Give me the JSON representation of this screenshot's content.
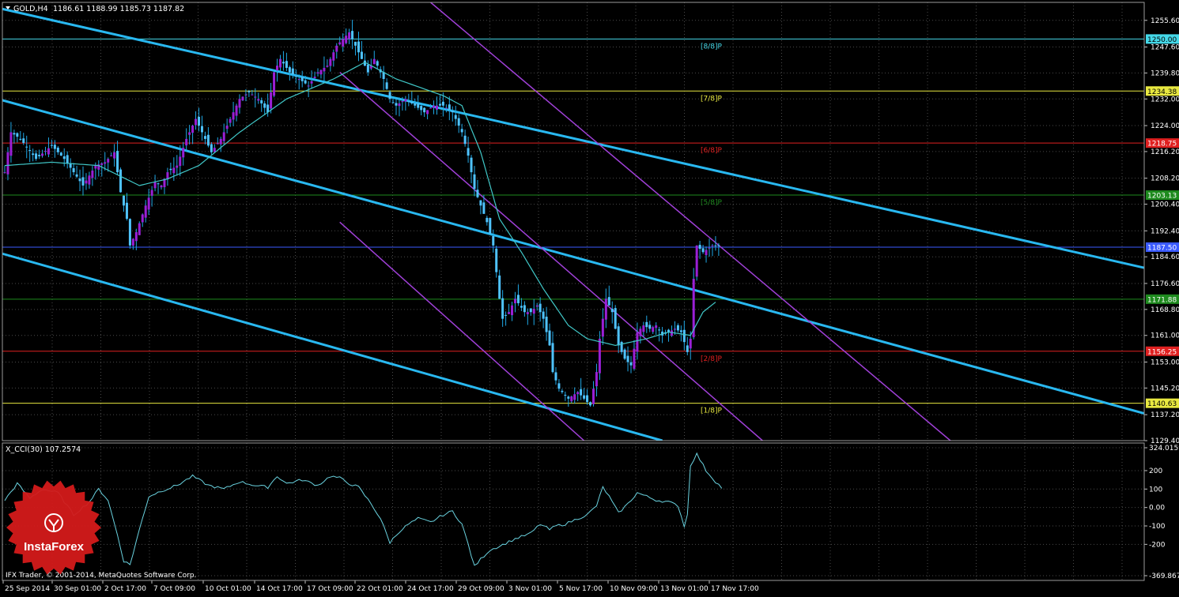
{
  "header": {
    "title": "GOLD,H4",
    "ohlc": "1186.61 1188.99 1185.73 1187.82",
    "menu_icon": "triangle-down-icon"
  },
  "indicator": {
    "label": "X_CCI(30) 107.2574"
  },
  "footer": {
    "copyright": "IFX Trader, © 2001-2014, MetaQuotes Software Corp."
  },
  "watermark": {
    "brand": "InstaForex"
  },
  "colors": {
    "background": "#000000",
    "grid": "#4a4a4a",
    "axis": "#c0c0c0",
    "bull_body": "#9a1fd6",
    "bear_body": "#4fc3ff",
    "wick": "#1fa8e6",
    "ma": "#40c8c8",
    "cci": "#6ad3e0",
    "channel": "#29b8f0",
    "channel_purple": "#a040d8",
    "level_88": "#44d8e8",
    "level_78": "#e8e840",
    "level_68": "#e02020",
    "level_58": "#1e8a1e",
    "level_48": "#3a5aff",
    "level_38": "#1e8a1e",
    "level_28": "#e02020",
    "level_18": "#e8e840",
    "watermark_red": "#d41a1a"
  },
  "chart_data": [
    {
      "type": "candlestick",
      "symbol": "GOLD",
      "timeframe": "H4",
      "ylim": [
        1129.4,
        1261.0
      ],
      "y_ticks": [
        "1255.60",
        "1247.60",
        "1239.80",
        "1232.00",
        "1224.00",
        "1216.20",
        "1208.20",
        "1200.40",
        "1192.40",
        "1184.60",
        "1176.60",
        "1168.80",
        "1161.00",
        "1153.00",
        "1145.20",
        "1137.20",
        "1129.40"
      ],
      "x_ticks": [
        "25 Sep 2014",
        "30 Sep 01:00",
        "2 Oct 17:00",
        "7 Oct 09:00",
        "10 Oct 01:00",
        "14 Oct 17:00",
        "17 Oct 09:00",
        "22 Oct 01:00",
        "24 Oct 17:00",
        "29 Oct 09:00",
        "3 Nov 01:00",
        "5 Nov 17:00",
        "10 Nov 09:00",
        "13 Nov 01:00",
        "17 Nov 17:00"
      ],
      "grid": true,
      "close_anchors": [
        [
          0,
          1210
        ],
        [
          2,
          1222
        ],
        [
          5,
          1220
        ],
        [
          10,
          1214
        ],
        [
          15,
          1218
        ],
        [
          19,
          1214
        ],
        [
          22,
          1210
        ],
        [
          25,
          1206
        ],
        [
          27,
          1209
        ],
        [
          29,
          1212
        ],
        [
          32,
          1213
        ],
        [
          35,
          1216
        ],
        [
          37,
          1204
        ],
        [
          39,
          1196
        ],
        [
          40,
          1188
        ],
        [
          42,
          1192
        ],
        [
          45,
          1200
        ],
        [
          48,
          1207
        ],
        [
          50,
          1206
        ],
        [
          52,
          1210
        ],
        [
          55,
          1212
        ],
        [
          58,
          1220
        ],
        [
          61,
          1226
        ],
        [
          63,
          1222
        ],
        [
          66,
          1216
        ],
        [
          69,
          1220
        ],
        [
          72,
          1226
        ],
        [
          75,
          1232
        ],
        [
          78,
          1234
        ],
        [
          81,
          1232
        ],
        [
          84,
          1228
        ],
        [
          86,
          1240
        ],
        [
          88,
          1244
        ],
        [
          91,
          1240
        ],
        [
          94,
          1238
        ],
        [
          97,
          1236
        ],
        [
          100,
          1240
        ],
        [
          103,
          1242
        ],
        [
          106,
          1248
        ],
        [
          108,
          1250
        ],
        [
          110,
          1252
        ],
        [
          112,
          1248
        ],
        [
          114,
          1244
        ],
        [
          116,
          1240
        ],
        [
          118,
          1244
        ],
        [
          121,
          1238
        ],
        [
          123,
          1232
        ],
        [
          125,
          1230
        ],
        [
          128,
          1232
        ],
        [
          131,
          1230
        ],
        [
          134,
          1228
        ],
        [
          137,
          1230
        ],
        [
          140,
          1230
        ],
        [
          143,
          1228
        ],
        [
          146,
          1222
        ],
        [
          148,
          1215
        ],
        [
          150,
          1205
        ],
        [
          152,
          1200
        ],
        [
          154,
          1195
        ],
        [
          156,
          1188
        ],
        [
          158,
          1172
        ],
        [
          159,
          1166
        ],
        [
          161,
          1168
        ],
        [
          163,
          1172
        ],
        [
          166,
          1168
        ],
        [
          168,
          1168
        ],
        [
          170,
          1170
        ],
        [
          172,
          1166
        ],
        [
          174,
          1158
        ],
        [
          175,
          1150
        ],
        [
          177,
          1145
        ],
        [
          180,
          1142
        ],
        [
          183,
          1144
        ],
        [
          185,
          1142
        ],
        [
          187,
          1140
        ],
        [
          189,
          1150
        ],
        [
          190,
          1160
        ],
        [
          192,
          1172
        ],
        [
          194,
          1168
        ],
        [
          196,
          1158
        ],
        [
          198,
          1154
        ],
        [
          200,
          1152
        ],
        [
          202,
          1162
        ],
        [
          204,
          1164
        ],
        [
          206,
          1163
        ],
        [
          208,
          1164
        ],
        [
          210,
          1161
        ],
        [
          212,
          1162
        ],
        [
          214,
          1163
        ],
        [
          216,
          1162
        ],
        [
          218,
          1156
        ],
        [
          219,
          1160
        ],
        [
          220,
          1178
        ],
        [
          221,
          1188
        ],
        [
          223,
          1186
        ],
        [
          226,
          1188
        ],
        [
          228,
          1187.82
        ]
      ],
      "moving_average": {
        "name": "MA",
        "anchors": [
          [
            0,
            1212
          ],
          [
            15,
            1213
          ],
          [
            30,
            1212
          ],
          [
            43,
            1206
          ],
          [
            52,
            1208
          ],
          [
            62,
            1212
          ],
          [
            75,
            1222
          ],
          [
            90,
            1232
          ],
          [
            105,
            1238
          ],
          [
            115,
            1243
          ],
          [
            125,
            1238
          ],
          [
            140,
            1233
          ],
          [
            146,
            1230
          ],
          [
            152,
            1216
          ],
          [
            158,
            1196
          ],
          [
            165,
            1186
          ],
          [
            172,
            1175
          ],
          [
            180,
            1164
          ],
          [
            186,
            1160
          ],
          [
            195,
            1158
          ],
          [
            205,
            1160
          ],
          [
            212,
            1162
          ],
          [
            219,
            1161
          ],
          [
            223,
            1168
          ],
          [
            227,
            1171
          ]
        ]
      },
      "levels": [
        {
          "price": 1250.0,
          "value_label": "1250.00",
          "tag": "[8/8]P",
          "color_key": "level_88"
        },
        {
          "price": 1234.38,
          "value_label": "1234.38",
          "tag": "[7/8]P",
          "color_key": "level_78"
        },
        {
          "price": 1218.75,
          "value_label": "1218.75",
          "tag": "[6/8]P",
          "color_key": "level_68"
        },
        {
          "price": 1203.13,
          "value_label": "1203.13",
          "tag": "[5/8]P",
          "color_key": "level_58"
        },
        {
          "price": 1187.5,
          "value_label": "1187.50",
          "tag": "",
          "color_key": "level_48"
        },
        {
          "price": 1171.88,
          "value_label": "1171.88",
          "tag": "",
          "color_key": "level_38"
        },
        {
          "price": 1156.25,
          "value_label": "1156.25",
          "tag": "[2/8]P",
          "color_key": "level_28"
        },
        {
          "price": 1140.63,
          "value_label": "1140.63",
          "tag": "[1/8]P",
          "color_key": "level_18"
        }
      ],
      "trendlines": [
        {
          "color_key": "channel",
          "from": [
            -10,
            1261.0
          ],
          "to": [
            370,
            1180.0
          ]
        },
        {
          "color_key": "channel",
          "from": [
            -10,
            1234.0
          ],
          "to": [
            370,
            1136.0
          ]
        },
        {
          "color_key": "channel",
          "from": [
            -10,
            1188.0
          ],
          "to": [
            210,
            1129.4
          ]
        },
        {
          "color_key": "channel_purple",
          "from": [
            136,
            1261.0
          ],
          "to": [
            302,
            1129.4
          ]
        },
        {
          "color_key": "channel_purple",
          "from": [
            107,
            1240.0
          ],
          "to": [
            242,
            1129.4
          ]
        },
        {
          "color_key": "channel_purple",
          "from": [
            107,
            1195.0
          ],
          "to": [
            185,
            1129.4
          ]
        }
      ]
    },
    {
      "type": "line",
      "name": "X_CCI(30)",
      "ylim": [
        -369.8679,
        324.0159
      ],
      "y_ticks": [
        "324.0159",
        "200",
        "100",
        "0.00",
        "-100",
        "-200",
        "-369.8679"
      ],
      "anchors": [
        [
          0,
          40
        ],
        [
          4,
          130
        ],
        [
          8,
          50
        ],
        [
          12,
          100
        ],
        [
          17,
          80
        ],
        [
          22,
          -40
        ],
        [
          27,
          30
        ],
        [
          30,
          100
        ],
        [
          33,
          40
        ],
        [
          36,
          -150
        ],
        [
          38,
          -290
        ],
        [
          40,
          -310
        ],
        [
          43,
          -120
        ],
        [
          46,
          60
        ],
        [
          50,
          90
        ],
        [
          55,
          120
        ],
        [
          60,
          170
        ],
        [
          65,
          120
        ],
        [
          70,
          100
        ],
        [
          75,
          140
        ],
        [
          80,
          120
        ],
        [
          84,
          110
        ],
        [
          87,
          170
        ],
        [
          90,
          130
        ],
        [
          95,
          150
        ],
        [
          100,
          120
        ],
        [
          104,
          170
        ],
        [
          107,
          160
        ],
        [
          110,
          130
        ],
        [
          113,
          110
        ],
        [
          117,
          20
        ],
        [
          120,
          -60
        ],
        [
          123,
          -190
        ],
        [
          126,
          -130
        ],
        [
          129,
          -90
        ],
        [
          132,
          -60
        ],
        [
          136,
          -80
        ],
        [
          140,
          -40
        ],
        [
          143,
          -20
        ],
        [
          146,
          -90
        ],
        [
          148,
          -200
        ],
        [
          150,
          -320
        ],
        [
          152,
          -280
        ],
        [
          155,
          -230
        ],
        [
          158,
          -210
        ],
        [
          163,
          -170
        ],
        [
          168,
          -140
        ],
        [
          171,
          -90
        ],
        [
          174,
          -120
        ],
        [
          176,
          -100
        ],
        [
          179,
          -90
        ],
        [
          183,
          -60
        ],
        [
          186,
          -40
        ],
        [
          189,
          10
        ],
        [
          191,
          110
        ],
        [
          193,
          60
        ],
        [
          196,
          -30
        ],
        [
          199,
          20
        ],
        [
          202,
          80
        ],
        [
          205,
          60
        ],
        [
          208,
          40
        ],
        [
          212,
          30
        ],
        [
          215,
          10
        ],
        [
          217,
          -100
        ],
        [
          218,
          -40
        ],
        [
          219,
          230
        ],
        [
          221,
          290
        ],
        [
          224,
          200
        ],
        [
          227,
          140
        ],
        [
          229,
          107
        ]
      ],
      "current": 107.2574
    }
  ]
}
